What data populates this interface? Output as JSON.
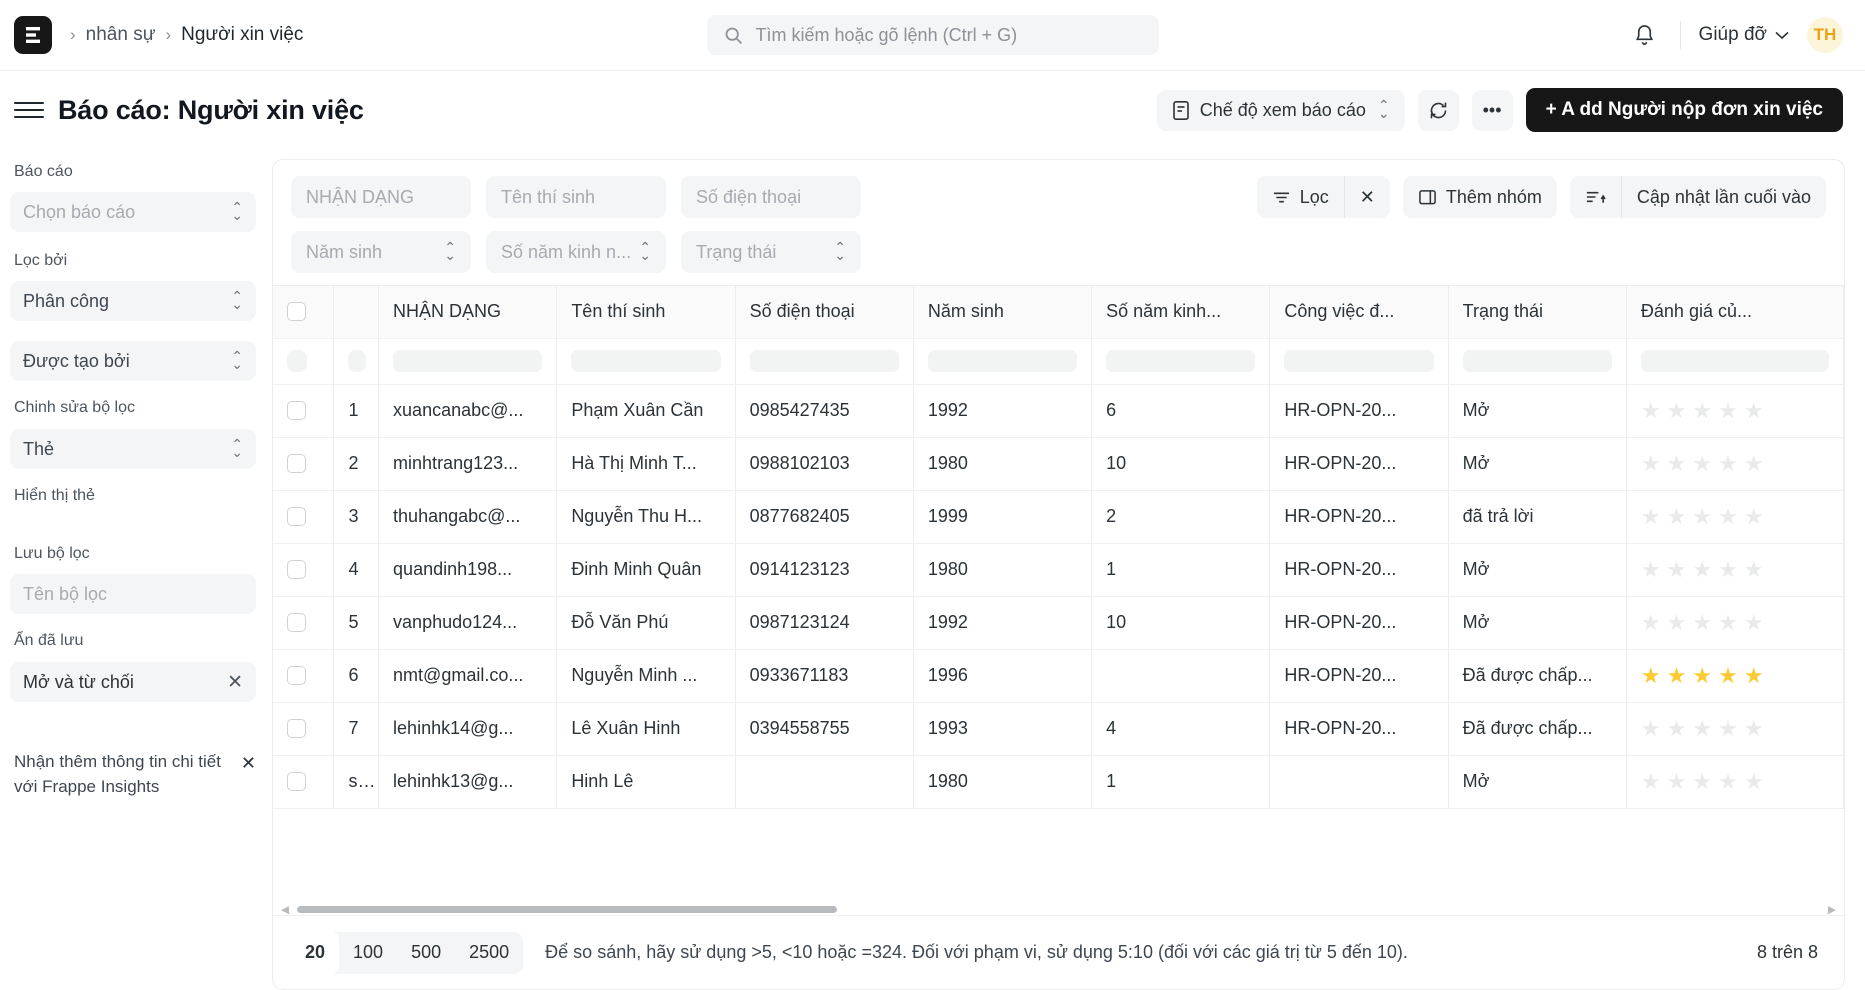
{
  "navbar": {
    "logo_text": "E",
    "breadcrumbs": [
      {
        "label": "nhân sự"
      },
      {
        "label": "Người xin việc"
      }
    ],
    "separator": "›",
    "search": {
      "placeholder": "Tìm kiếm hoặc gõ lệnh (Ctrl + G)",
      "value": "",
      "icon": "search-icon"
    },
    "bell_icon": "bell-icon",
    "help_label": "Giúp đỡ",
    "help_caret": "chevron-down-icon",
    "avatar_initials": "TH"
  },
  "pagebar": {
    "menu_icon": "hamburger-icon",
    "title": "Báo cáo: Người xin việc",
    "report_view_label": "Chế độ xem báo cáo",
    "report_view_icon": "document-icon",
    "refresh_icon": "refresh-icon",
    "more_label": "•••",
    "add_label": "+ A dd Người nộp đơn xin việc"
  },
  "sidebar": {
    "report_label": "Báo cáo",
    "report_select": {
      "value": "Chọn báo cáo",
      "placeholder": true
    },
    "filter_by_label": "Lọc bởi",
    "filter_selects": [
      {
        "value": "Phân công"
      },
      {
        "value": "Được tạo bởi"
      }
    ],
    "edit_filters_label": "Chinh sửa bộ lọc",
    "tag_select": {
      "value": "Thẻ"
    },
    "show_tags_label": "Hiển thị thẻ",
    "save_filter_label": "Lưu bộ lọc",
    "filter_name_input": {
      "placeholder": "Tên bộ lọc",
      "value": ""
    },
    "hide_saved_label": "Ẩn đã lưu",
    "saved_filter": {
      "label": "Mở và từ chối",
      "close_icon": "close-icon"
    },
    "insights_text": "Nhận thêm thông tin chi tiết với Frappe Insights",
    "insights_close_icon": "close-icon"
  },
  "filters": {
    "row1": [
      {
        "placeholder": "NHẬN DẠNG",
        "value": "",
        "type": "text"
      },
      {
        "placeholder": "Tên thí sinh",
        "value": "",
        "type": "text"
      },
      {
        "placeholder": "Số điện thoại",
        "value": "",
        "type": "text"
      }
    ],
    "row2": [
      {
        "placeholder": "Năm sinh",
        "value": "",
        "type": "select"
      },
      {
        "placeholder": "Số năm kinh n...",
        "value": "",
        "type": "select"
      },
      {
        "placeholder": "Trạng thái",
        "value": "",
        "type": "select"
      }
    ],
    "filter_button": {
      "label": "Lọc",
      "icon": "filter-icon"
    },
    "filter_clear_icon": "close-icon",
    "group_button": {
      "label": "Thêm nhóm",
      "icon": "folder-icon"
    },
    "sort_icon": "sort-asc-icon",
    "sort_button": {
      "label": "Cập nhật lần cuối vào"
    }
  },
  "table": {
    "columns": [
      {
        "key": "check",
        "label": ""
      },
      {
        "key": "idx",
        "label": ""
      },
      {
        "key": "id",
        "label": "NHẬN DẠNG"
      },
      {
        "key": "name",
        "label": "Tên thí sinh"
      },
      {
        "key": "phone",
        "label": "Số điện thoại"
      },
      {
        "key": "year",
        "label": "Năm sinh"
      },
      {
        "key": "exp",
        "label": "Số năm kinh..."
      },
      {
        "key": "job",
        "label": "Công việc đ..."
      },
      {
        "key": "status",
        "label": "Trạng thái"
      },
      {
        "key": "rating",
        "label": "Đánh giá củ..."
      }
    ],
    "rows": [
      {
        "idx": "1",
        "id": "xuancanabc@...",
        "name": "Phạm Xuân Cần",
        "phone": "0985427435",
        "year": "1992",
        "exp": "6",
        "job": "HR-OPN-20...",
        "status": "Mở",
        "rating": 0
      },
      {
        "idx": "2",
        "id": "minhtrang123...",
        "name": "Hà Thị Minh T...",
        "phone": "0988102103",
        "year": "1980",
        "exp": "10",
        "job": "HR-OPN-20...",
        "status": "Mở",
        "rating": 0
      },
      {
        "idx": "3",
        "id": "thuhangabc@...",
        "name": "Nguyễn Thu H...",
        "phone": "0877682405",
        "year": "1999",
        "exp": "2",
        "job": "HR-OPN-20...",
        "status": "đã trả lời",
        "rating": 0
      },
      {
        "idx": "4",
        "id": "quandinh198...",
        "name": "Đinh Minh Quân",
        "phone": "0914123123",
        "year": "1980",
        "exp": "1",
        "job": "HR-OPN-20...",
        "status": "Mở",
        "rating": 0
      },
      {
        "idx": "5",
        "id": "vanphudo124...",
        "name": "Đỗ Văn Phú",
        "phone": "0987123124",
        "year": "1992",
        "exp": "10",
        "job": "HR-OPN-20...",
        "status": "Mở",
        "rating": 0
      },
      {
        "idx": "6",
        "id": "nmt@gmail.co...",
        "name": "Nguyễn Minh ...",
        "phone": "0933671183",
        "year": "1996",
        "exp": "",
        "job": "HR-OPN-20...",
        "status": "Đã được chấp...",
        "rating": 5
      },
      {
        "idx": "7",
        "id": "lehinhk14@g...",
        "name": "Lê Xuân Hinh",
        "phone": "0394558755",
        "year": "1993",
        "exp": "4",
        "job": "HR-OPN-20...",
        "status": "Đã được chấp...",
        "rating": 0
      },
      {
        "idx": "s...",
        "id": "lehinhk13@g...",
        "name": "Hinh Lê",
        "phone": "",
        "year": "1980",
        "exp": "1",
        "job": "",
        "status": "Mở",
        "rating": 0
      }
    ],
    "star_glyph": "★",
    "star_on_color": "#fbcb33",
    "star_off_color": "#e9eaea"
  },
  "footer": {
    "page_sizes": [
      {
        "label": "20",
        "active": true
      },
      {
        "label": "100",
        "active": false
      },
      {
        "label": "500",
        "active": false
      },
      {
        "label": "2500",
        "active": false
      }
    ],
    "hint": "Để so sánh, hãy sử dụng >5, <10 hoặc =324. Đối với phạm vi, sử dụng 5:10 (đối với các giá trị từ 5 đến 10).",
    "count": "8 trên 8"
  }
}
